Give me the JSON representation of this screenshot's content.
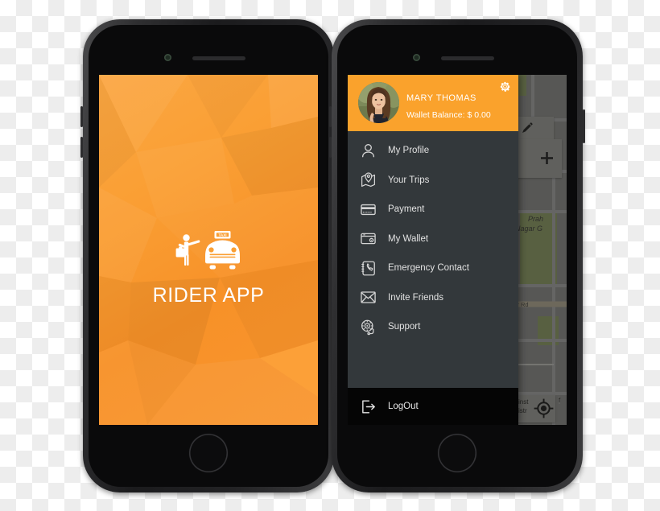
{
  "left_phone": {
    "splash": {
      "app_title": "RIDER APP",
      "logo_icon": "taxi-hail-icon",
      "background_color": "#fa9f34"
    }
  },
  "right_phone": {
    "drawer": {
      "header": {
        "avatar_icon": "user-avatar-photo",
        "user_name": "MARY THOMAS",
        "wallet_balance": "Wallet Balance: $ 0.00",
        "settings_icon": "gear-icon",
        "background_color": "#faa22c"
      },
      "items": [
        {
          "label": "My Profile",
          "icon": "person-icon"
        },
        {
          "label": "Your Trips",
          "icon": "map-pin-icon"
        },
        {
          "label": "Payment",
          "icon": "credit-card-icon"
        },
        {
          "label": "My Wallet",
          "icon": "wallet-icon"
        },
        {
          "label": "Emergency Contact",
          "icon": "phone-book-icon"
        },
        {
          "label": "Invite Friends",
          "icon": "envelope-icon"
        },
        {
          "label": "Support",
          "icon": "headset-icon"
        }
      ],
      "logout": {
        "label": "LogOut",
        "icon": "logout-arrow-icon"
      },
      "background_color": "#33383b"
    },
    "map": {
      "labels": [
        "Prah",
        "Nagar G",
        "nandnagar Rd"
      ],
      "bottom_chips": [
        "inst",
        "istr",
        "f"
      ],
      "controls": [
        {
          "icon": "more-dots-icon"
        },
        {
          "icon": "pencil-edit-icon"
        },
        {
          "icon": "zoom-in-plus-icon"
        },
        {
          "icon": "my-location-icon"
        }
      ]
    }
  }
}
